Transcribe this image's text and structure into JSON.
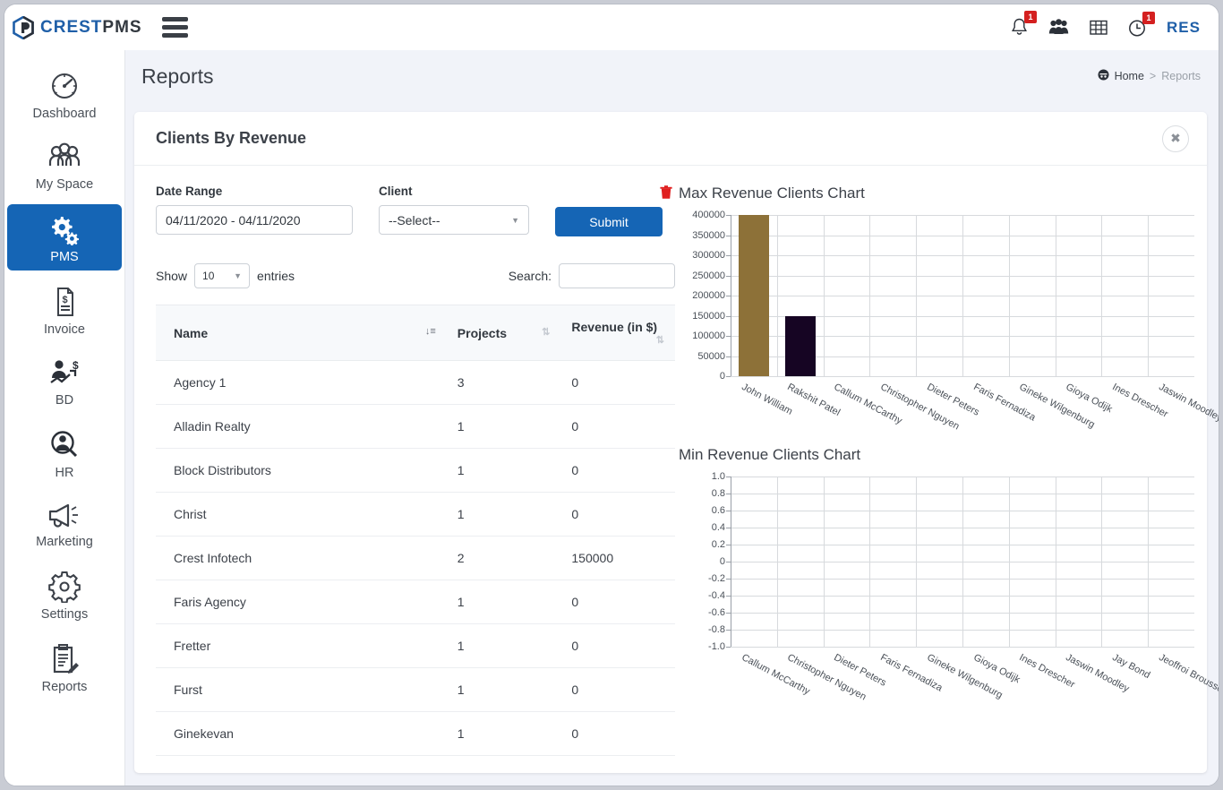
{
  "app": {
    "logo_crest": "CREST",
    "logo_pms": "PMS"
  },
  "topbar": {
    "notifications_badge": "1",
    "clock_badge": "1",
    "user_initials": "RES"
  },
  "sidebar": {
    "items": [
      {
        "label": "Dashboard",
        "icon": "speedometer-icon",
        "active": false
      },
      {
        "label": "My Space",
        "icon": "people-group-icon",
        "active": false
      },
      {
        "label": "PMS",
        "icon": "gears-icon",
        "active": true
      },
      {
        "label": "Invoice",
        "icon": "invoice-document-icon",
        "active": false
      },
      {
        "label": "BD",
        "icon": "business-growth-icon",
        "active": false
      },
      {
        "label": "HR",
        "icon": "person-search-icon",
        "active": false
      },
      {
        "label": "Marketing",
        "icon": "megaphone-icon",
        "active": false
      },
      {
        "label": "Settings",
        "icon": "gear-icon",
        "active": false
      },
      {
        "label": "Reports",
        "icon": "clipboard-pencil-icon",
        "active": false
      }
    ]
  },
  "page": {
    "title": "Reports",
    "breadcrumb_home": "Home",
    "breadcrumb_sep": ">",
    "breadcrumb_current": "Reports"
  },
  "card": {
    "title": "Clients By Revenue",
    "close_label": "✖"
  },
  "filters": {
    "date_range_label": "Date Range",
    "date_range_value": "04/11/2020 - 04/11/2020",
    "client_label": "Client",
    "client_value": "--Select--",
    "submit_label": "Submit",
    "delete_icon": "trash-icon"
  },
  "table_controls": {
    "show_label": "Show",
    "show_value": "10",
    "entries_label": "entries",
    "search_label": "Search:",
    "search_value": "",
    "search_placeholder": ""
  },
  "table": {
    "columns": [
      {
        "label": "Name",
        "sorted": true,
        "sort_glyph": "↓≡"
      },
      {
        "label": "Projects",
        "sorted": false,
        "sort_glyph": "⇅"
      },
      {
        "label": "Revenue (in $)",
        "sorted": false,
        "sort_glyph": "⇅"
      }
    ],
    "rows": [
      {
        "name": "Agency 1",
        "projects": "3",
        "revenue": "0"
      },
      {
        "name": "Alladin Realty",
        "projects": "1",
        "revenue": "0"
      },
      {
        "name": "Block Distributors",
        "projects": "1",
        "revenue": "0"
      },
      {
        "name": "Christ",
        "projects": "1",
        "revenue": "0"
      },
      {
        "name": "Crest Infotech",
        "projects": "2",
        "revenue": "150000"
      },
      {
        "name": "Faris Agency",
        "projects": "1",
        "revenue": "0"
      },
      {
        "name": "Fretter",
        "projects": "1",
        "revenue": "0"
      },
      {
        "name": "Furst",
        "projects": "1",
        "revenue": "0"
      },
      {
        "name": "Ginekevan",
        "projects": "1",
        "revenue": "0"
      }
    ]
  },
  "chart_data": [
    {
      "type": "bar",
      "title": "Max Revenue Clients Chart",
      "xlabel": "",
      "ylabel": "",
      "categories": [
        "John William",
        "Rakshit Patel",
        "Callum McCarthy",
        "Christopher Nguyen",
        "Dieter Peters",
        "Faris Fernadiza",
        "Gineke Wilgenburg",
        "Gioya Odijk",
        "Ines Drescher",
        "Jaswin Moodley"
      ],
      "values": [
        400000,
        148000,
        0,
        0,
        0,
        0,
        0,
        0,
        0,
        0
      ],
      "bar_colors": [
        "#8d7138",
        "#160523",
        "#8d7138",
        "#160523",
        "#8d7138",
        "#160523",
        "#8d7138",
        "#160523",
        "#8d7138",
        "#160523"
      ],
      "ylim": [
        0,
        400000
      ],
      "yticks": [
        0,
        50000,
        100000,
        150000,
        200000,
        250000,
        300000,
        350000,
        400000
      ],
      "ytick_labels": [
        "0",
        "50000",
        "100000",
        "150000",
        "200000",
        "250000",
        "300000",
        "350000",
        "400000"
      ],
      "grid": true,
      "legend": "none"
    },
    {
      "type": "bar",
      "title": "Min Revenue Clients Chart",
      "xlabel": "",
      "ylabel": "",
      "categories": [
        "Callum McCarthy",
        "Christopher Nguyen",
        "Dieter Peters",
        "Faris Fernadiza",
        "Gineke Wilgenburg",
        "Gioya Odijk",
        "Ines Drescher",
        "Jaswin Moodley",
        "Jay Bond",
        "Jeoffroi Brousse"
      ],
      "values": [
        0,
        0,
        0,
        0,
        0,
        0,
        0,
        0,
        0,
        0
      ],
      "bar_colors": [],
      "ylim": [
        -1.0,
        1.0
      ],
      "yticks": [
        -1.0,
        -0.8,
        -0.6,
        -0.4,
        -0.2,
        0,
        0.2,
        0.4,
        0.6,
        0.8,
        1.0
      ],
      "ytick_labels": [
        "-1.0",
        "-0.8",
        "-0.6",
        "-0.4",
        "-0.2",
        "0",
        "0.2",
        "0.4",
        "0.6",
        "0.8",
        "1.0"
      ],
      "grid": true,
      "legend": "none"
    }
  ]
}
